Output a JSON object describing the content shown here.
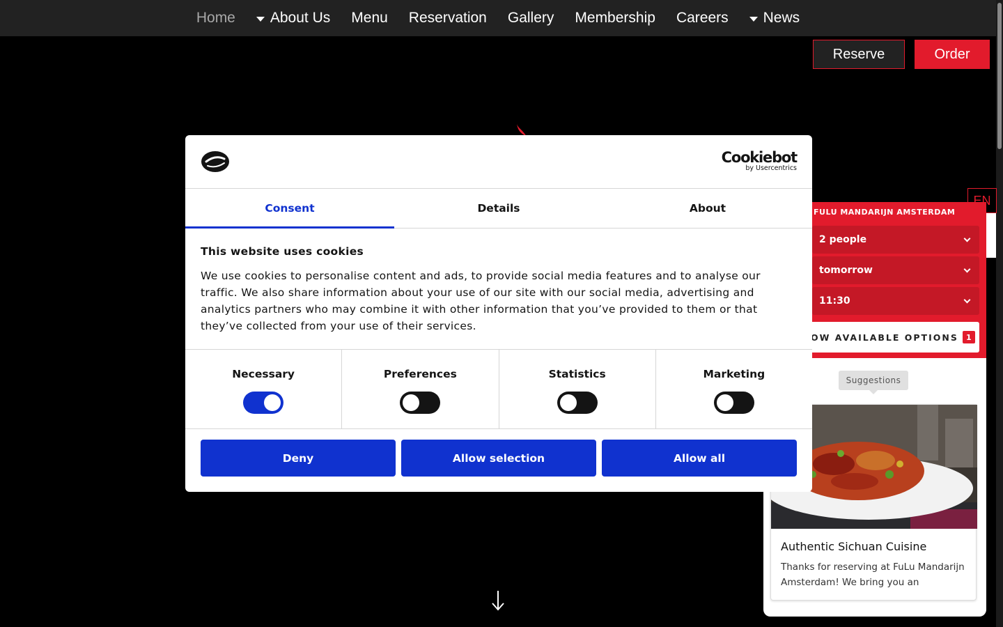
{
  "nav": {
    "items": [
      {
        "label": "Home",
        "active": true,
        "dropdown": false
      },
      {
        "label": "About Us",
        "active": false,
        "dropdown": true
      },
      {
        "label": "Menu",
        "active": false,
        "dropdown": false
      },
      {
        "label": "Reservation",
        "active": false,
        "dropdown": false
      },
      {
        "label": "Gallery",
        "active": false,
        "dropdown": false
      },
      {
        "label": "Membership",
        "active": false,
        "dropdown": false
      },
      {
        "label": "Careers",
        "active": false,
        "dropdown": false
      },
      {
        "label": "News",
        "active": false,
        "dropdown": true
      }
    ]
  },
  "header_actions": {
    "reserve": "Reserve",
    "order": "Order"
  },
  "language": "EN",
  "widget": {
    "title": "FULU MANDARIJN AMSTERDAM",
    "party": "2 people",
    "date": "tomorrow",
    "time": "11:30",
    "options_label": "OW AVAILABLE OPTIONS",
    "options_count": "1",
    "suggestions_label": "Suggestions",
    "card": {
      "title": "Authentic Sichuan Cuisine",
      "text": "Thanks for reserving at FuLu Mandarijn Amsterdam! We bring you an"
    }
  },
  "cookie": {
    "brand": "Cookiebot",
    "brand_sub": "by Usercentrics",
    "tabs": [
      {
        "label": "Consent",
        "active": true
      },
      {
        "label": "Details",
        "active": false
      },
      {
        "label": "About",
        "active": false
      }
    ],
    "heading": "This website uses cookies",
    "body": "We use cookies to personalise content and ads, to provide social media features and to analyse our traffic. We also share information about your use of our site with our social media, advertising and analytics partners who may combine it with other information that you’ve provided to them or that they’ve collected from your use of their services.",
    "categories": [
      {
        "label": "Necessary",
        "on": true
      },
      {
        "label": "Preferences",
        "on": false
      },
      {
        "label": "Statistics",
        "on": false
      },
      {
        "label": "Marketing",
        "on": false
      }
    ],
    "buttons": {
      "deny": "Deny",
      "allow_selection": "Allow selection",
      "allow_all": "Allow all"
    }
  },
  "colors": {
    "brand_red": "#e21b2c",
    "cookie_blue": "#1032cf",
    "nav_bg": "#222222"
  }
}
